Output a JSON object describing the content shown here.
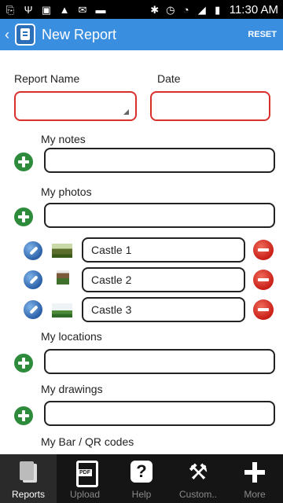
{
  "status_bar": {
    "time": "11:30 AM",
    "icons": [
      "usb-debug-icon",
      "usb-icon",
      "image-icon",
      "warning-icon",
      "gmail-icon",
      "media-icon",
      "bluetooth-icon",
      "alarm-icon",
      "wifi-icon",
      "signal-icon",
      "battery-icon"
    ]
  },
  "action_bar": {
    "title": "New Report",
    "reset_label": "RESET",
    "accent_color": "#3a8ee0"
  },
  "form": {
    "report_name_label": "Report Name",
    "date_label": "Date",
    "report_name_value": "",
    "date_value": "",
    "notes_label": "My notes",
    "notes_value": "",
    "photos_label": "My photos",
    "photos_value": "",
    "photos": [
      {
        "caption": "Castle 1",
        "thumb": "castle-photo-thumbnail"
      },
      {
        "caption": "Castle 2",
        "thumb": "castle-photo-thumbnail"
      },
      {
        "caption": "Castle 3",
        "thumb": "castle-photo-thumbnail"
      }
    ],
    "locations_label": "My locations",
    "locations_value": "",
    "drawings_label": "My drawings",
    "drawings_value": "",
    "codes_label": "My Bar / QR codes"
  },
  "bottom_nav": {
    "items": [
      {
        "label": "Reports",
        "icon": "reports-icon",
        "active": true
      },
      {
        "label": "Upload",
        "icon": "pdf-icon",
        "active": false
      },
      {
        "label": "Help",
        "icon": "help-icon",
        "active": false
      },
      {
        "label": "Custom..",
        "icon": "tools-icon",
        "active": false
      },
      {
        "label": "More",
        "icon": "plus-icon",
        "active": false
      }
    ]
  }
}
